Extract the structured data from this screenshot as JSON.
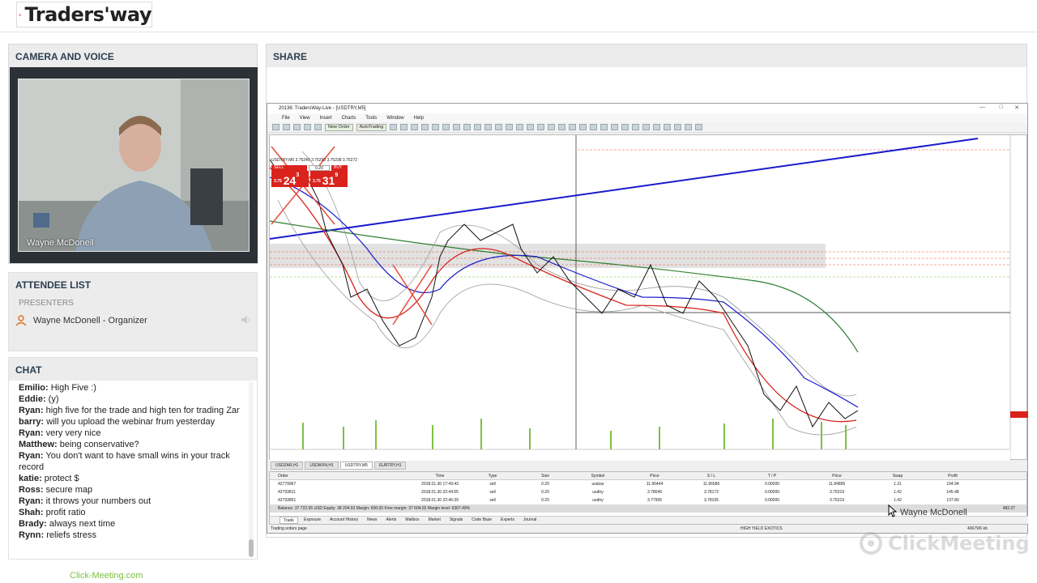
{
  "brand": {
    "name": "Traders'way"
  },
  "camera": {
    "title": "Camera and Voice",
    "presenter_name": "Wayne McDonell"
  },
  "attendees": {
    "title": "Attendee List",
    "section": "Presenters",
    "items": [
      {
        "label": "Wayne McDonell - Organizer"
      }
    ]
  },
  "chat": {
    "title": "Chat",
    "messages": [
      {
        "user": "Emilio:",
        "text": " High Five :)"
      },
      {
        "user": "Eddie:",
        "text": " (y)"
      },
      {
        "user": "Ryan:",
        "text": " high five for the trade and high ten for trading Zar"
      },
      {
        "user": "barry:",
        "text": " will you upload the webinar frum yesterday"
      },
      {
        "user": "Ryan:",
        "text": " very very nice"
      },
      {
        "user": "Matthew:",
        "text": " being conservative?"
      },
      {
        "user": "Ryan:",
        "text": " You don't want to have small wins in your track record"
      },
      {
        "user": "katie:",
        "text": " protect $"
      },
      {
        "user": "Ross:",
        "text": " secure map"
      },
      {
        "user": "Ryan:",
        "text": " it throws your numbers out"
      },
      {
        "user": "Shah:",
        "text": " profit ratio"
      },
      {
        "user": "Brady:",
        "text": " always next time"
      },
      {
        "user": "Rynn:",
        "text": " reliefs stress"
      }
    ]
  },
  "footer": {
    "link": "Click-Meeting.com"
  },
  "share": {
    "title": "Share",
    "window_title": "20136: TradersWay-Live - [USDTRY,M5]",
    "menu": [
      "File",
      "View",
      "Insert",
      "Charts",
      "Tools",
      "Window",
      "Help"
    ],
    "toolbar": {
      "new_order": "New Order",
      "autotrading": "AutoTrading"
    },
    "symbol_label": "USDTRY,M5  3.75240 3.75290 3.75238 3.75272",
    "sell_label": "SELL",
    "buy_label": "BUY",
    "lot": "0.20",
    "sell_price": {
      "prefix": "3.75",
      "big": "24",
      "sup": "3"
    },
    "buy_price": {
      "prefix": "3.75",
      "big": "31",
      "sup": "9"
    },
    "chart_tabs": [
      "USDZAR,H1",
      "USDMXN,H1",
      "USDTRY,M5",
      "EURTRY,H1"
    ],
    "active_chart_tab": "USDTRY,M5",
    "terminal": {
      "columns": [
        "Order",
        "Time",
        "Type",
        "Size",
        "Symbol",
        "Price",
        "S / L",
        "T / P",
        "Price",
        "Swap",
        "Profit"
      ],
      "rows": [
        [
          "42779967",
          "2018.01.30 17:49:43",
          "sell",
          "0.20",
          "usdzar",
          "11.96444",
          "11.96586",
          "0.00000",
          "11.84895",
          "1.31",
          "194.94"
        ],
        [
          "42793811",
          "2018.01.30 22:44:55",
          "sell",
          "0.20",
          "usdtry",
          "3.78049",
          "3.78172",
          "0.00000",
          "3.75319",
          "1.42",
          "145.48"
        ],
        [
          "42793851",
          "2018.01.30 22:46:39",
          "sell",
          "0.20",
          "usdtry",
          "3.77905",
          "3.78105",
          "0.00000",
          "3.75319",
          "1.42",
          "137.80"
        ]
      ],
      "balance": "Balance: 37 722.55 USD  Equity: 38 204.92  Margin: 600.00  Free margin: 37 604.92  Margin level: 6367.49%",
      "balance_profit": "482.37",
      "tabs": [
        "Trade",
        "Exposure",
        "Account History",
        "News",
        "Alerts",
        "Mailbox",
        "Market",
        "Signals",
        "Code Base",
        "Experts",
        "Journal"
      ]
    },
    "status": {
      "left": "Trading orders page",
      "middle": "HIGH YIELD EXOTICS",
      "right": "40679/6 kb"
    },
    "cursor_label": "Wayne McDonell"
  },
  "watermark": {
    "text": "ClickMeeting"
  },
  "colors": {
    "red": "#d9231c",
    "blue": "#1a1acc",
    "green": "#2e7d2e",
    "accent_green": "#7cc242"
  }
}
